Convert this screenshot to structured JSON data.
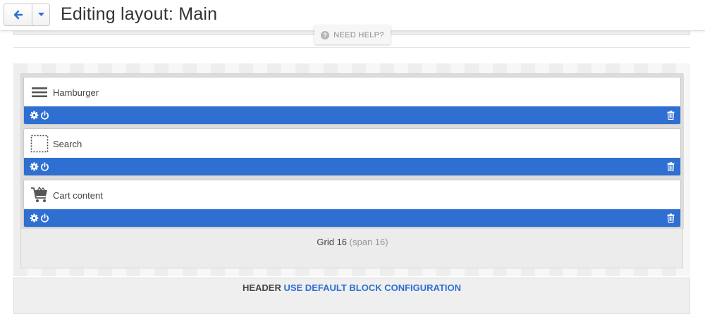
{
  "header": {
    "title": "Editing layout: Main",
    "back_icon": "arrow-left-icon",
    "dropdown_icon": "caret-down-icon"
  },
  "help": {
    "label": "NEED HELP?",
    "icon": "question-circle-icon"
  },
  "grid": {
    "label": "Grid 16",
    "span": "(span 16)",
    "blocks": [
      {
        "name": "Hamburger",
        "icon": "hamburger-icon"
      },
      {
        "name": "Search",
        "icon": "dotted-square-icon"
      },
      {
        "name": "Cart content",
        "icon": "shopping-cart-icon"
      }
    ],
    "block_actions": [
      "gear-icon",
      "power-icon",
      "trash-icon"
    ]
  },
  "section": {
    "name": "HEADER",
    "link": "USE DEFAULT BLOCK CONFIGURATION"
  },
  "colors": {
    "accent": "#2f6fd2",
    "block_bar": "#2f6fd2",
    "link": "#2f6fd2"
  }
}
